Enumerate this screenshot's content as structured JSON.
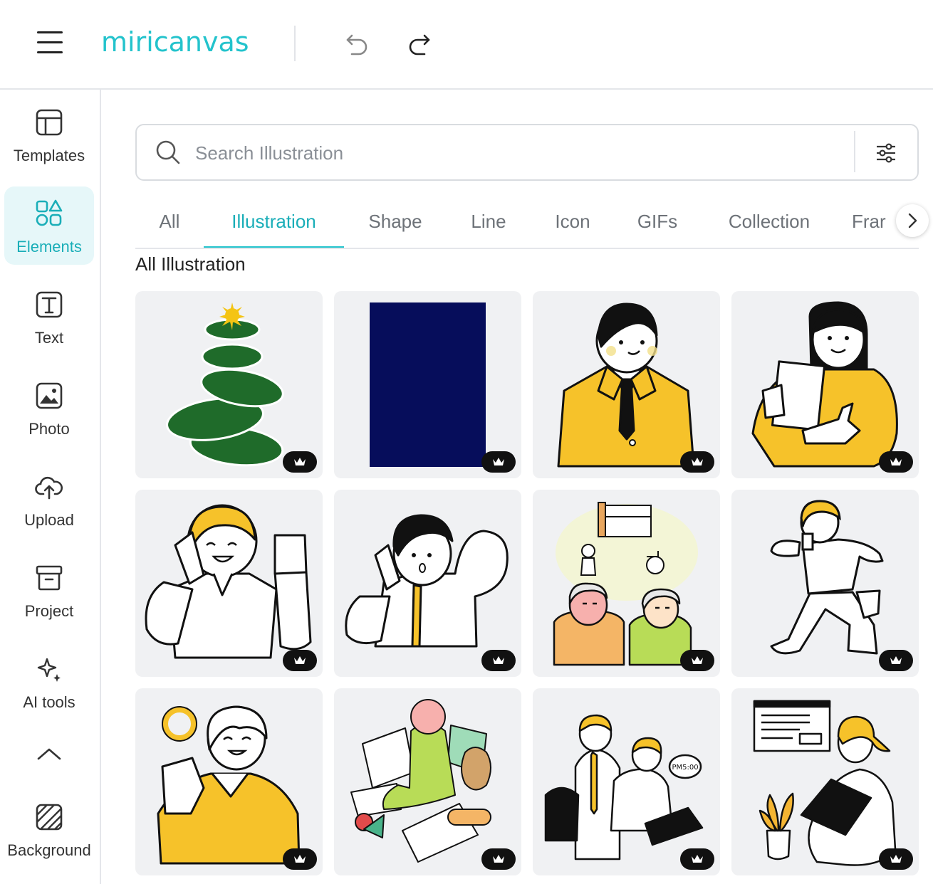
{
  "app": {
    "brand": "miricanvas",
    "accent_color": "#23c3cc"
  },
  "topbar": {
    "menu_icon": "hamburger-icon",
    "undo_icon": "undo-icon",
    "redo_icon": "redo-icon"
  },
  "sidebar": {
    "items": [
      {
        "label": "Templates",
        "icon": "templates-icon",
        "active": false
      },
      {
        "label": "Elements",
        "icon": "elements-icon",
        "active": true
      },
      {
        "label": "Text",
        "icon": "text-icon",
        "active": false
      },
      {
        "label": "Photo",
        "icon": "photo-icon",
        "active": false
      },
      {
        "label": "Upload",
        "icon": "upload-cloud-icon",
        "active": false
      },
      {
        "label": "Project",
        "icon": "project-box-icon",
        "active": false
      },
      {
        "label": "AI tools",
        "icon": "sparkle-icon",
        "active": false
      },
      {
        "label": "Background",
        "icon": "background-hatch-icon",
        "active": false
      }
    ],
    "collapse_icon": "chevron-up-icon"
  },
  "search": {
    "placeholder": "Search Illustration",
    "value": "",
    "filter_icon": "filter-sliders-icon"
  },
  "tabs": [
    "All",
    "Illustration",
    "Shape",
    "Line",
    "Icon",
    "GIFs",
    "Collection",
    "Frar"
  ],
  "active_tab": "Illustration",
  "section": {
    "title": "All Illustration"
  },
  "grid": {
    "items": [
      {
        "name": "green-stacked-tree-illustration",
        "premium": true
      },
      {
        "name": "navy-rectangle-illustration",
        "premium": true
      },
      {
        "name": "businessman-yellow-suit-illustration",
        "premium": true
      },
      {
        "name": "woman-holding-paper-thumbs-up-illustration",
        "premium": true
      },
      {
        "name": "man-on-phone-fist-illustration",
        "premium": true
      },
      {
        "name": "man-on-phone-surprised-illustration",
        "premium": true
      },
      {
        "name": "elderly-couple-care-illustration",
        "premium": true
      },
      {
        "name": "running-person-phone-illustration",
        "premium": true
      },
      {
        "name": "woman-holding-ring-illustration",
        "premium": true
      },
      {
        "name": "baby-playing-books-illustration",
        "premium": true
      },
      {
        "name": "office-workers-laptop-illustration",
        "premium": true
      },
      {
        "name": "woman-laptop-plant-illustration",
        "premium": true
      }
    ],
    "badge_icon": "premium-crown-icon",
    "speech_bubble_text": "PM5:00"
  }
}
